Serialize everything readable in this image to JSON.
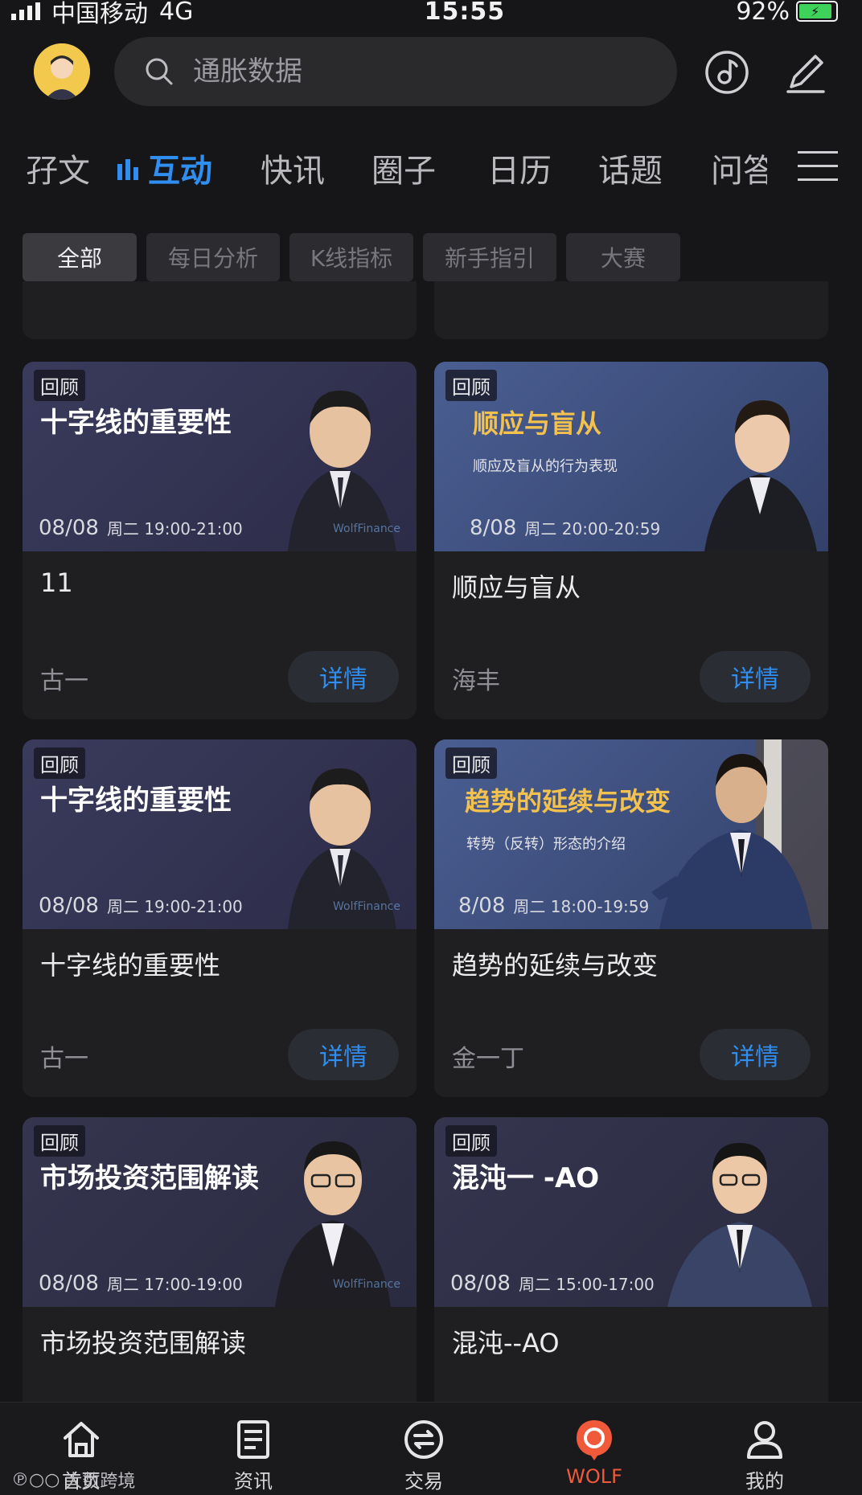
{
  "status_bar": {
    "carrier": "中国移动",
    "network": "4G",
    "time": "15:55",
    "battery": "92%"
  },
  "search": {
    "placeholder": "通胀数据"
  },
  "header_icons": [
    "music-disc-icon",
    "edit-pen-icon"
  ],
  "tabs": [
    {
      "label": "孖文"
    },
    {
      "label": "互动",
      "active": true
    },
    {
      "label": "快讯"
    },
    {
      "label": "圈子"
    },
    {
      "label": "日历"
    },
    {
      "label": "话题"
    },
    {
      "label": "问答"
    }
  ],
  "chips": [
    {
      "label": "全部",
      "active": true
    },
    {
      "label": "每日分析"
    },
    {
      "label": "K线指标"
    },
    {
      "label": "新手指引"
    },
    {
      "label": "大赛"
    }
  ],
  "cards": [
    {
      "tag": "回顾",
      "banner_title": "十字线的重要性",
      "banner_sub": "",
      "date": "08/08",
      "weekday_time": "周二  19:00-21:00",
      "name": "11",
      "author": "古一",
      "detail_label": "详情",
      "bg": "#3a3a5c"
    },
    {
      "tag": "回顾",
      "banner_title": "顺应与盲从",
      "banner_sub": "顺应及盲从的行为表现",
      "date": "8/08",
      "weekday_time": "周二  20:00-20:59",
      "name": "顺应与盲从",
      "author": "海丰",
      "detail_label": "详情",
      "bg": "#3f4f7c"
    },
    {
      "tag": "回顾",
      "banner_title": "十字线的重要性",
      "banner_sub": "",
      "date": "08/08",
      "weekday_time": "周二  19:00-21:00",
      "name": "十字线的重要性",
      "author": "古一",
      "detail_label": "详情",
      "bg": "#3a3a5c"
    },
    {
      "tag": "回顾",
      "banner_title": "趋势的延续与改变",
      "banner_sub": "转势（反转）形态的介绍",
      "date": "8/08",
      "weekday_time": "周二  18:00-19:59",
      "name": "趋势的延续与改变",
      "author": "金一丁",
      "detail_label": "详情",
      "bg": "#3f4f7c"
    },
    {
      "tag": "回顾",
      "banner_title": "市场投资范围解读",
      "banner_sub": "",
      "date": "08/08",
      "weekday_time": "周二  17:00-19:00",
      "name": "市场投资范围解读",
      "author": "",
      "detail_label": "",
      "bg": "#34344f"
    },
    {
      "tag": "回顾",
      "banner_title": "混沌一  -AO",
      "banner_sub": "",
      "date": "08/08",
      "weekday_time": "周二  15:00-17:00",
      "name": "混沌--AO",
      "author": "",
      "detail_label": "",
      "bg": "#34344f"
    }
  ],
  "bottom_nav": [
    {
      "label": "首页",
      "icon": "home-icon"
    },
    {
      "label": "资讯",
      "icon": "news-icon"
    },
    {
      "label": "交易",
      "icon": "exchange-icon"
    },
    {
      "label": "WOLF",
      "icon": "wolf-icon",
      "active": true
    },
    {
      "label": "我的",
      "icon": "profile-icon"
    }
  ],
  "watermark": "大数跨境",
  "brand_watermark": "WolfFinance",
  "colors": {
    "accent": "#2f8ef0",
    "active_nav": "#f05a3a",
    "background": "#161618",
    "card": "#1f1f22"
  }
}
